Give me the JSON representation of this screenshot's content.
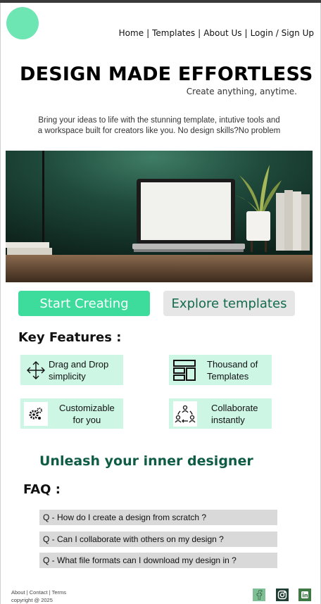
{
  "brand": {
    "logo_color": "#6ee6b4",
    "accent": "#3ddc9c",
    "dark_green": "#0f5c44"
  },
  "nav": {
    "items": [
      {
        "label": "Home"
      },
      {
        "label": "Templates"
      },
      {
        "label": "About Us"
      },
      {
        "label": "Login / Sign Up"
      }
    ],
    "separator": "|"
  },
  "hero": {
    "title": "DESIGN MADE EFFORTLESS",
    "subtitle": "Create anything, anytime.",
    "intro_line1": "Bring your ideas to life with the stunning template, intutive tools and",
    "intro_line2": "a workspace built for creators like you. No design skills?No problem",
    "image_icon": "laptop-on-desk-photo"
  },
  "cta": {
    "primary_label": "Start Creating",
    "secondary_label": "Explore templates"
  },
  "features": {
    "title": "Key Features :",
    "items": [
      {
        "line1": "Drag and Drop",
        "line2": "simplicity",
        "icon": "move-arrows-icon"
      },
      {
        "line1": "Thousand of",
        "line2": "Templates",
        "icon": "template-grid-icon"
      },
      {
        "line1": "Customizable",
        "line2": "for you",
        "icon": "gears-icon"
      },
      {
        "line1": "Collaborate",
        "line2": "instantly",
        "icon": "team-cycle-icon"
      }
    ]
  },
  "tagline": "Unleash your inner designer",
  "faq": {
    "title": "FAQ :",
    "items": [
      {
        "q": "Q - How do I create a design from scratch ?"
      },
      {
        "q": "Q - Can I collaborate with others on my design ?"
      },
      {
        "q": "Q - What file formats can I download my design in ?"
      }
    ]
  },
  "footer": {
    "links": [
      "About",
      "Contact",
      "Terms"
    ],
    "separator": "|",
    "copyright": "copyright @ 2025",
    "social": [
      {
        "icon": "facebook-icon",
        "color": "#7fbf95"
      },
      {
        "icon": "instagram-icon",
        "color": "#1f3d33"
      },
      {
        "icon": "linkedin-icon",
        "color": "#3f7a45"
      }
    ]
  }
}
